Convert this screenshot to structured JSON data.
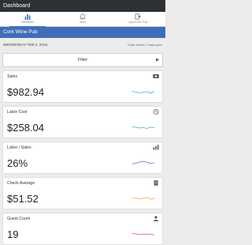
{
  "window": {
    "title": "Dashboard"
  },
  "tabs": [
    {
      "label": "Dashboard",
      "icon": "bar-chart-icon",
      "active": true
    },
    {
      "label": "Alerts",
      "icon": "bell-icon",
      "active": false
    },
    {
      "label": "Logout Sam Pole",
      "icon": "logout-icon",
      "active": false
    }
  ],
  "location": {
    "name": "Cork Wine Pub"
  },
  "date": {
    "text": "WEDNESDAY FEB 4, 2015",
    "hint": "Chart shows 7 days prior"
  },
  "filter": {
    "label": "Filter"
  },
  "colors": {
    "topbar": "#2d3136",
    "location": "#3f6db8",
    "accent": "#4d7cc4"
  },
  "metrics": [
    {
      "title": "Sales",
      "value": "$982.94",
      "icon": "money-icon",
      "spark_color": "#5b9fd4",
      "spark": [
        0.55,
        0.45,
        0.35,
        0.45,
        0.5,
        0.3,
        0.55
      ]
    },
    {
      "title": "Labor Cost",
      "value": "$258.04",
      "icon": "clock-icon",
      "spark_color": "#3fb5a0",
      "spark": [
        0.55,
        0.5,
        0.4,
        0.45,
        0.35,
        0.5,
        0.45
      ]
    },
    {
      "title": "Labor / Sales",
      "value": "26%",
      "icon": "percent-chart-icon",
      "spark_color": "#7a5fc0",
      "spark": [
        0.35,
        0.45,
        0.6,
        0.7,
        0.55,
        0.45,
        0.5
      ]
    },
    {
      "title": "Check Average",
      "value": "$51.52",
      "icon": "receipt-icon",
      "spark_color": "#f0a030",
      "spark": [
        0.5,
        0.55,
        0.45,
        0.5,
        0.6,
        0.4,
        0.5
      ]
    },
    {
      "title": "Guest Count",
      "value": "19",
      "icon": "guests-icon",
      "spark_color": "#e05050",
      "spark": [
        0.55,
        0.5,
        0.4,
        0.5,
        0.45,
        0.5,
        0.35
      ]
    }
  ]
}
